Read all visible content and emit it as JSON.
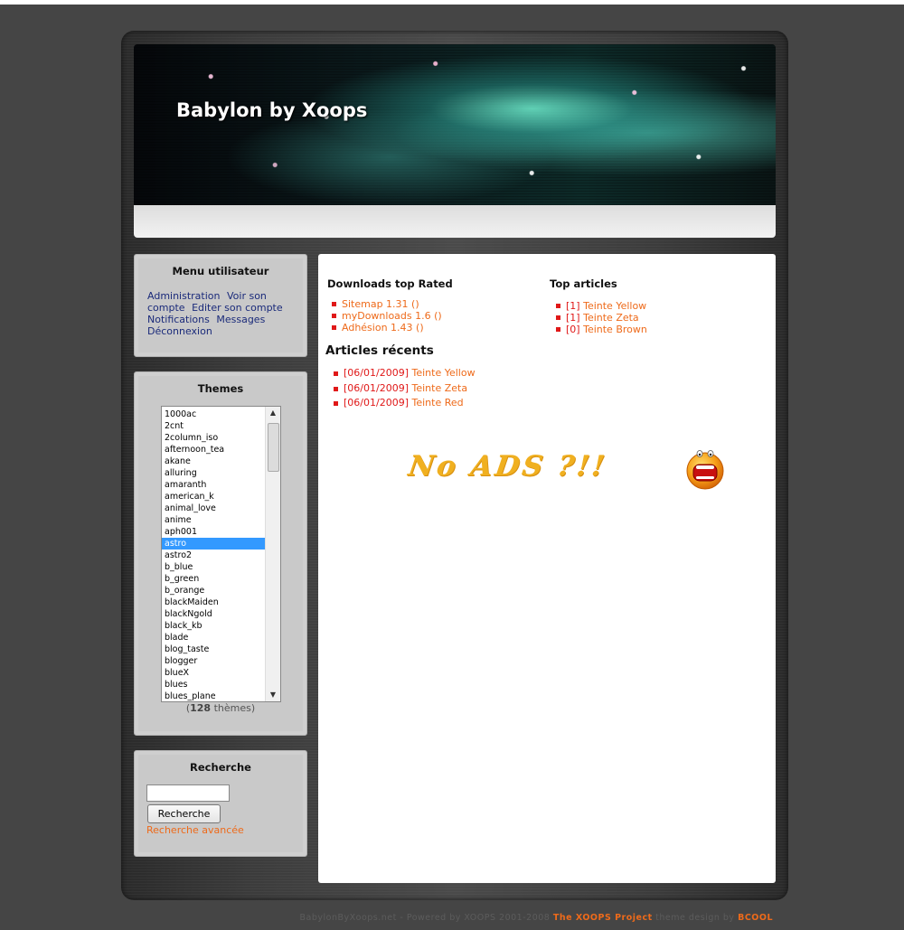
{
  "site": {
    "title": "Babylon by Xoops"
  },
  "user_menu": {
    "title": "Menu utilisateur",
    "links": [
      "Administration",
      "Voir son compte",
      "Editer son compte",
      "Notifications",
      "Messages",
      "Déconnexion"
    ]
  },
  "themes": {
    "title": "Themes",
    "items": [
      "1000ac",
      "2cnt",
      "2column_iso",
      "afternoon_tea",
      "akane",
      "alluring",
      "amaranth",
      "american_k",
      "animal_love",
      "anime",
      "aph001",
      "astro",
      "astro2",
      "b_blue",
      "b_green",
      "b_orange",
      "blackMaiden",
      "blackNgold",
      "black_kb",
      "blade",
      "blog_taste",
      "blogger",
      "blueX",
      "blues",
      "blues_plane"
    ],
    "selected": "astro",
    "count_prefix": "(",
    "count": "128",
    "count_suffix": " thèmes)"
  },
  "search": {
    "title": "Recherche",
    "input_value": "",
    "button_label": "Recherche",
    "advanced_link": "Recherche avancée"
  },
  "main": {
    "downloads": {
      "title": "Downloads top Rated",
      "items": [
        {
          "label": "Sitemap 1.31",
          "suffix": "()"
        },
        {
          "label": "myDownloads 1.6",
          "suffix": "()"
        },
        {
          "label": "Adhésion 1.43",
          "suffix": "()"
        }
      ]
    },
    "top_articles": {
      "title": "Top articles",
      "items": [
        {
          "count": "[1]",
          "label": "Teinte Yellow"
        },
        {
          "count": "[1]",
          "label": "Teinte Zeta"
        },
        {
          "count": "[0]",
          "label": "Teinte Brown"
        }
      ]
    },
    "recent": {
      "title": "Articles récents",
      "items": [
        {
          "date": "[06/01/2009]",
          "label": "Teinte Yellow"
        },
        {
          "date": "[06/01/2009]",
          "label": "Teinte Zeta"
        },
        {
          "date": "[06/01/2009]",
          "label": "Teinte Red"
        }
      ]
    },
    "ad_text": "No ADS ?!!"
  },
  "footer": {
    "text": "BabylonByXoops.net - Powered by XOOPS 2001-2008 ",
    "project_link": "The XOOPS Project",
    "design_text": " theme design by ",
    "designer": "BCOOL"
  },
  "colors": {
    "accent": "#ee6a1a",
    "bullet": "#e01818",
    "selected": "#3399ff"
  }
}
